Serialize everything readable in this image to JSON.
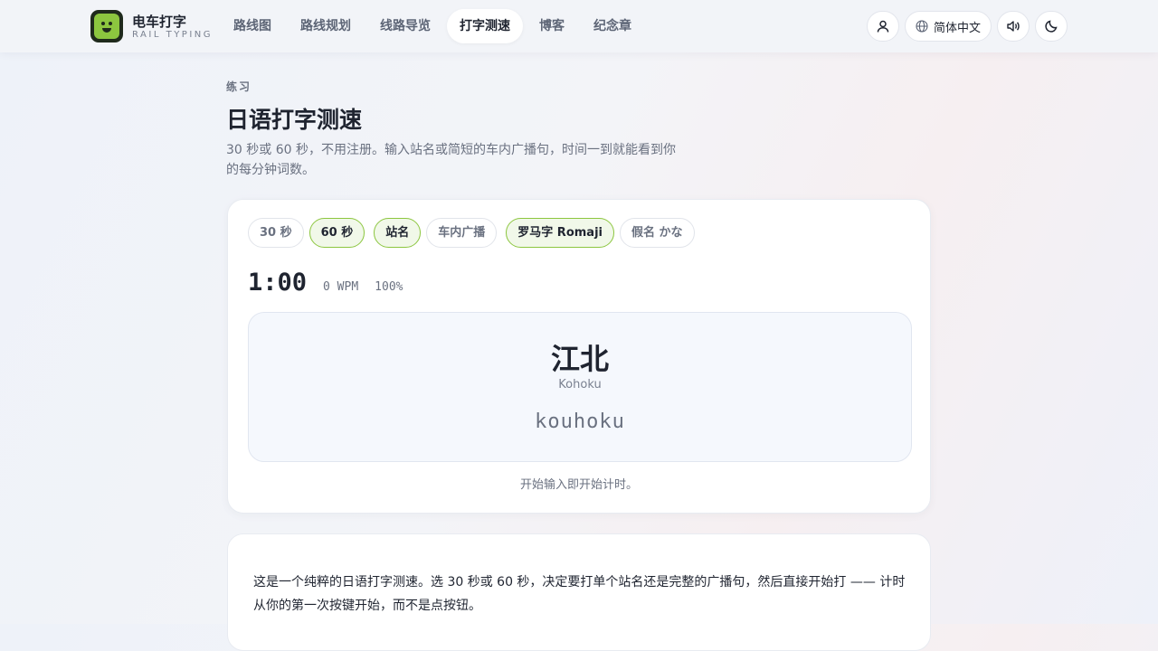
{
  "brand": {
    "title": "电车打字",
    "subtitle": "RAIL TYPING"
  },
  "nav": [
    {
      "label": "路线图",
      "active": false
    },
    {
      "label": "路线规划",
      "active": false
    },
    {
      "label": "线路导览",
      "active": false
    },
    {
      "label": "打字测速",
      "active": true
    },
    {
      "label": "博客",
      "active": false
    },
    {
      "label": "纪念章",
      "active": false
    }
  ],
  "header_actions": {
    "language_label": "简体中文"
  },
  "intro": {
    "eyebrow": "练习",
    "title": "日语打字测速",
    "description": "30 秒或 60 秒，不用注册。输入站名或简短的车内广播句，时间一到就能看到你的每分钟词数。"
  },
  "test": {
    "duration_options": [
      {
        "label": "30 秒",
        "selected": false
      },
      {
        "label": "60 秒",
        "selected": true
      }
    ],
    "content_options": [
      {
        "label": "站名",
        "selected": true
      },
      {
        "label": "车内广播",
        "selected": false
      }
    ],
    "script_options": [
      {
        "label": "罗马字 Romaji",
        "selected": true
      },
      {
        "label": "假名 かな",
        "selected": false
      }
    ],
    "timer": "1:00",
    "wpm": "0 WPM",
    "accuracy": "100%",
    "word": {
      "kanji": "江北",
      "reading": "Kohoku",
      "romaji": "kouhoku"
    },
    "hint": "开始输入即开始计时。"
  },
  "info": {
    "text": "这是一个纯粹的日语打字测速。选 30 秒或 60 秒，决定要打单个站名还是完整的广播句，然后直接开始打 —— 计时从你的第一次按键开始，而不是点按钮。"
  },
  "colors": {
    "accent": "#8cc63f",
    "accent_bg": "#f1f8e9",
    "text": "#1f2430",
    "muted": "#6a7180"
  }
}
